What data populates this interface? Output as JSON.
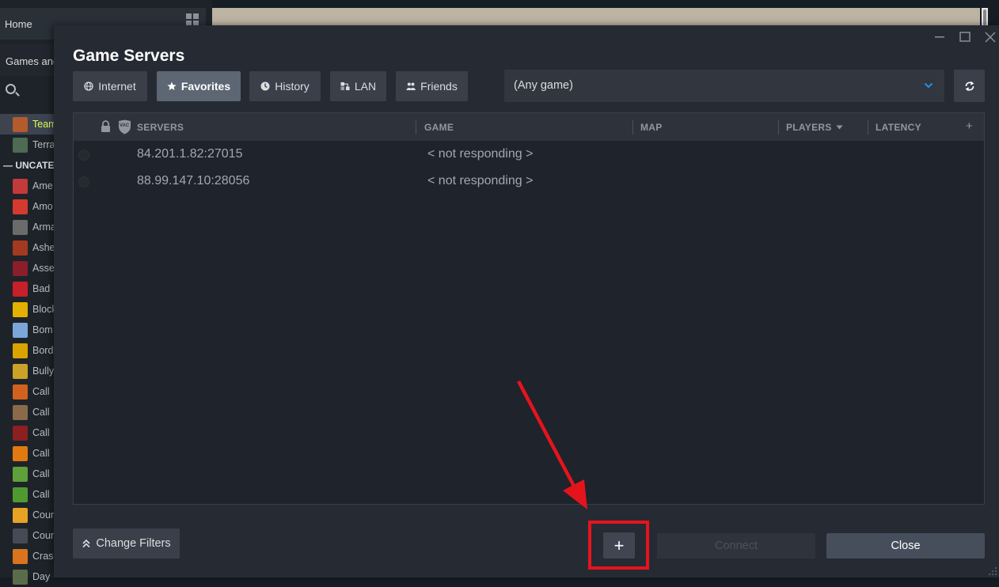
{
  "library": {
    "home": "Home",
    "games_filter": "Games and",
    "category": "UNCATE",
    "games": [
      {
        "name": "Team",
        "color": "#b35b2c",
        "active": true
      },
      {
        "name": "Terra",
        "color": "#4c6b52",
        "active": false
      },
      {
        "name": "Ame",
        "color": "#c23a3a",
        "active": false
      },
      {
        "name": "Amo",
        "color": "#d43b2e",
        "active": false
      },
      {
        "name": "Arma",
        "color": "#6b6b6b",
        "active": false
      },
      {
        "name": "Ashe",
        "color": "#a33a1f",
        "active": false
      },
      {
        "name": "Asse",
        "color": "#8a1e2a",
        "active": false
      },
      {
        "name": "Bad",
        "color": "#c8202a",
        "active": false
      },
      {
        "name": "Block",
        "color": "#e2b000",
        "active": false
      },
      {
        "name": "Bom",
        "color": "#7aa7d8",
        "active": false
      },
      {
        "name": "Bord",
        "color": "#d9a400",
        "active": false
      },
      {
        "name": "Bully",
        "color": "#c9a227",
        "active": false
      },
      {
        "name": "Call",
        "color": "#d1621e",
        "active": false
      },
      {
        "name": "Call",
        "color": "#8a6a4a",
        "active": false
      },
      {
        "name": "Call",
        "color": "#8c1f1f",
        "active": false
      },
      {
        "name": "Call",
        "color": "#e07a10",
        "active": false
      },
      {
        "name": "Call",
        "color": "#5fa03a",
        "active": false
      },
      {
        "name": "Call",
        "color": "#4f9a30",
        "active": false
      },
      {
        "name": "Coun",
        "color": "#e8a325",
        "active": false
      },
      {
        "name": "Coun",
        "color": "#444b55",
        "active": false
      },
      {
        "name": "Crash",
        "color": "#d9731f",
        "active": false
      },
      {
        "name": "Day",
        "color": "#5a6d4a",
        "active": false
      }
    ]
  },
  "dialog": {
    "title": "Game Servers",
    "tabs": [
      {
        "label": "Internet",
        "icon": "globe-icon",
        "active": false
      },
      {
        "label": "Favorites",
        "icon": "star-icon",
        "active": true
      },
      {
        "label": "History",
        "icon": "clock-icon",
        "active": false
      },
      {
        "label": "LAN",
        "icon": "network-icon",
        "active": false
      },
      {
        "label": "Friends",
        "icon": "friends-icon",
        "active": false
      }
    ],
    "game_filter": "(Any game)",
    "columns": {
      "servers": "SERVERS",
      "game": "GAME",
      "map": "MAP",
      "players": "PLAYERS",
      "latency": "LATENCY",
      "add": "+",
      "vac": "VAC"
    },
    "servers": [
      {
        "address": "84.201.1.82:27015",
        "game": "< not responding >"
      },
      {
        "address": "88.99.147.10:28056",
        "game": "< not responding >"
      }
    ],
    "buttons": {
      "change_filters": "Change Filters",
      "add": "+",
      "connect": "Connect",
      "close": "Close"
    }
  },
  "colors": {
    "accent_red": "#e5141c",
    "active_tab": "#5d6673",
    "dialog_bg": "#262a33"
  }
}
